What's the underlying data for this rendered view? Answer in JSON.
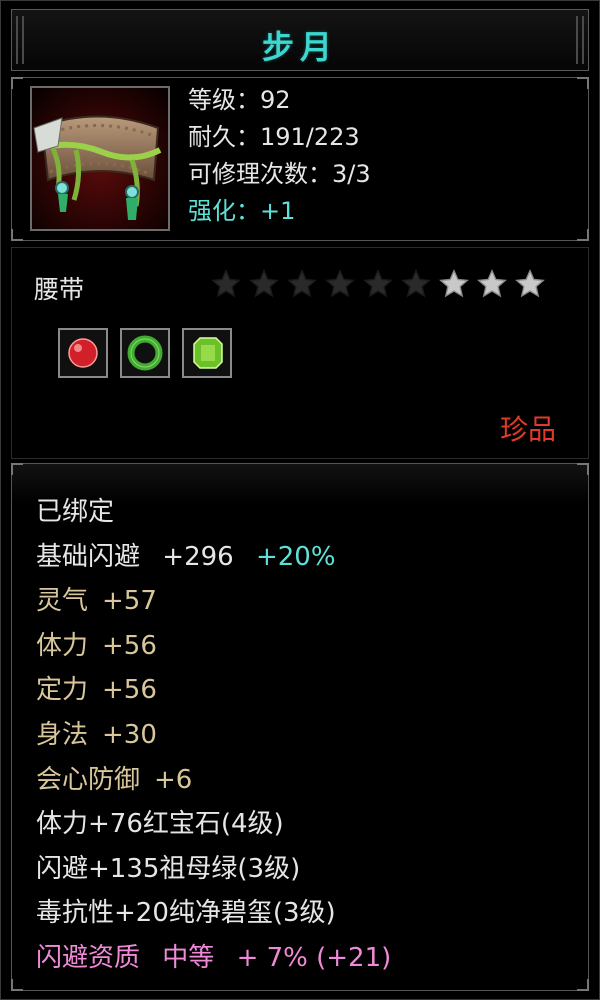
{
  "item": {
    "name": "步月",
    "level": "等级：92",
    "durability": "耐久：191/223",
    "repairs": "可修理次数：3/3",
    "enhance": "强化：+1",
    "type": "腰带",
    "stars_total": 9,
    "stars_active": 3,
    "rarity": "珍品",
    "icon": "belt-icon"
  },
  "gems": [
    {
      "name": "ruby-gem-icon",
      "color": "#d2202a"
    },
    {
      "name": "emerald-ring-gem-icon",
      "color": "#3fae2e"
    },
    {
      "name": "jade-square-gem-icon",
      "color": "#6cc12a"
    }
  ],
  "stats": {
    "bound": "已绑定",
    "base_dodge_label": "基础闪避",
    "base_dodge_value": "+296",
    "base_dodge_bonus": "+20%",
    "attrs": [
      {
        "label": "灵气",
        "value": "+57"
      },
      {
        "label": "体力",
        "value": "+56"
      },
      {
        "label": "定力",
        "value": "+56"
      },
      {
        "label": "身法",
        "value": "+30"
      },
      {
        "label": "会心防御",
        "value": "+6"
      }
    ],
    "gem_lines": [
      "体力+76红宝石(4级)",
      "闪避+135祖母绿(3级)",
      "毒抗性+20纯净碧玺(3级)"
    ],
    "quality_label": "闪避资质",
    "quality_grade": "中等",
    "quality_value": "+ 7% (+21)"
  },
  "colors": {
    "title": "#3fd6cf",
    "rarity": "#e03a2a",
    "enhance": "#5fe0d8",
    "attr": "#d8c79a",
    "quality": "#f08ad8"
  }
}
